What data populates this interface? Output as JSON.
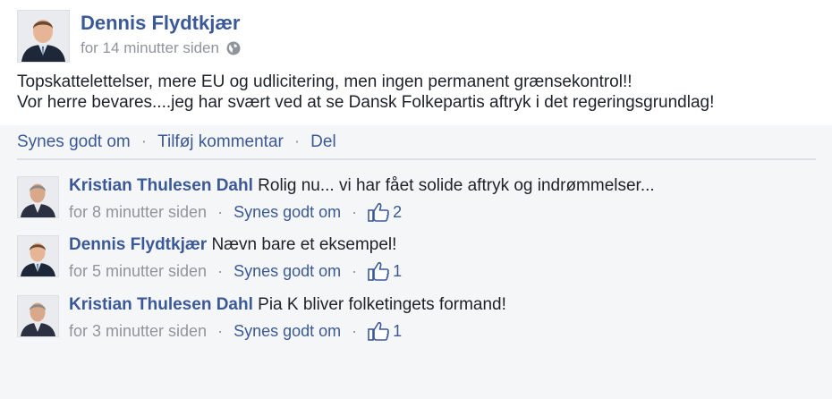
{
  "post": {
    "author": "Dennis Flydtkjær",
    "timestamp": "for 14 minutter siden",
    "visibility_icon": "globe-icon",
    "text_lines": [
      "Topskattelettelser, mere EU og udlicitering, men ingen permanent grænsekontrol!!",
      "Vor herre bevares....jeg har svært ved at se Dansk Folkepartis aftryk i det regeringsgrundlag!"
    ]
  },
  "actions": {
    "like": "Synes godt om",
    "comment": "Tilføj kommentar",
    "share": "Del",
    "separator": "·"
  },
  "comments": [
    {
      "author": "Kristian Thulesen Dahl",
      "text": "Rolig nu... vi har fået solide aftryk og indrømmelser...",
      "timestamp": "for 8 minutter siden",
      "like_label": "Synes godt om",
      "like_count": "2"
    },
    {
      "author": "Dennis Flydtkjær",
      "text": "Nævn bare et eksempel!",
      "timestamp": "for 5 minutter siden",
      "like_label": "Synes godt om",
      "like_count": "1"
    },
    {
      "author": "Kristian Thulesen Dahl",
      "text": "Pia K bliver folketingets formand!",
      "timestamp": "for 3 minutter siden",
      "like_label": "Synes godt om",
      "like_count": "1"
    }
  ],
  "colors": {
    "link": "#3b5998",
    "meta": "#90949c",
    "text": "#1d2129",
    "comment_bg": "#f5f6f7"
  }
}
